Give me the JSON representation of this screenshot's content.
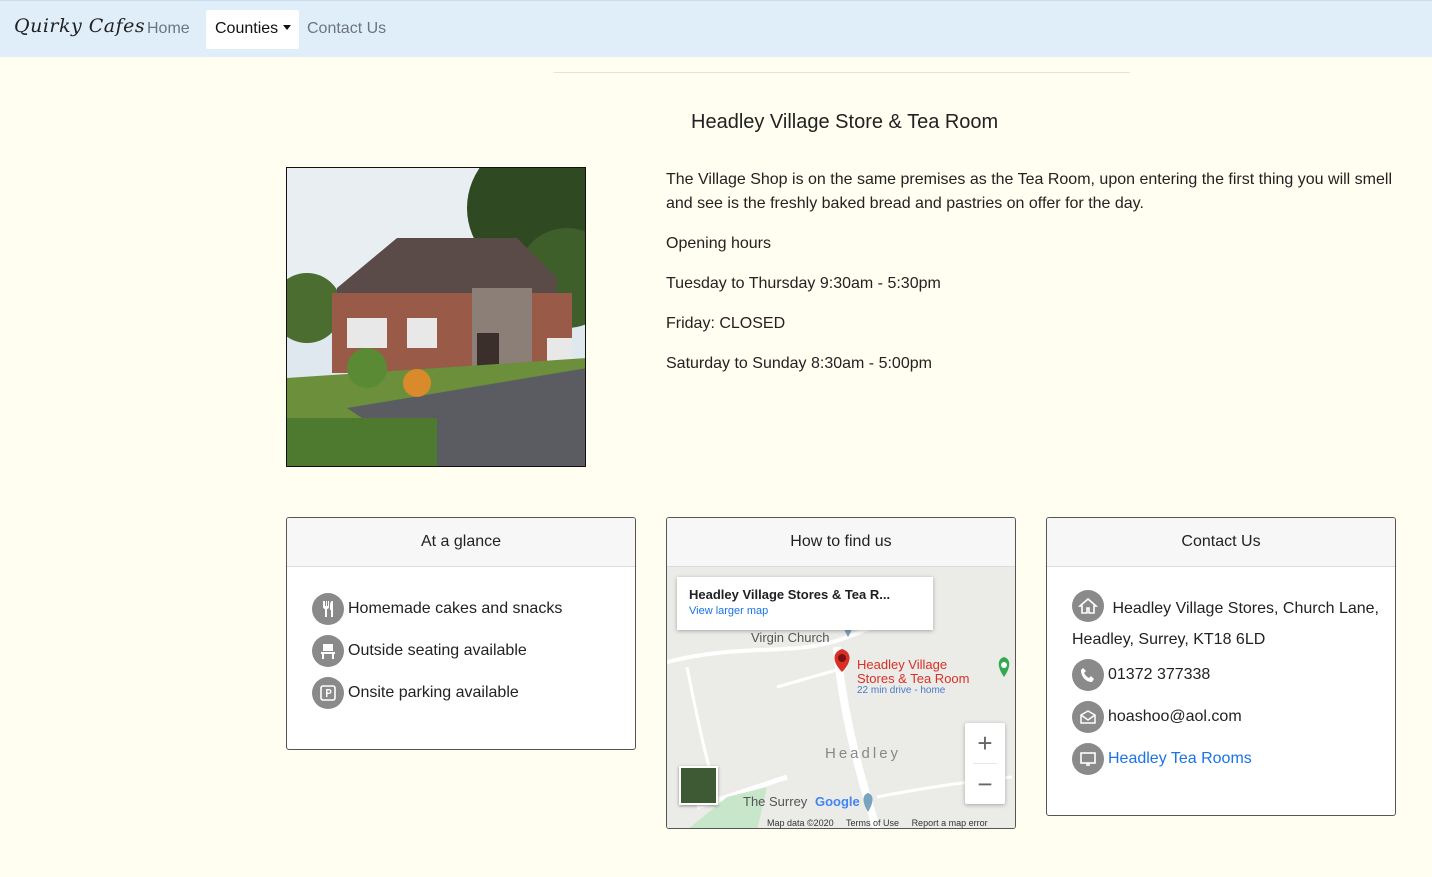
{
  "nav": {
    "brand": "Quirky Cafes",
    "home": "Home",
    "counties": "Counties",
    "contact": "Contact Us"
  },
  "page": {
    "title": "Headley Village Store & Tea Room"
  },
  "description": {
    "intro": "The Village Shop is on the same premises as the Tea Room, upon entering the first thing you will smell and see is the freshly baked bread and pastries on offer for the day.",
    "hours_heading": "Opening hours",
    "hours": [
      "Tuesday to Thursday 9:30am - 5:30pm",
      "Friday: CLOSED",
      "Saturday to Sunday 8:30am - 5:00pm"
    ]
  },
  "glance": {
    "heading": "At a glance",
    "items": [
      {
        "icon": "cutlery-icon",
        "text": "Homemade cakes and snacks"
      },
      {
        "icon": "bench-icon",
        "text": "Outside seating available"
      },
      {
        "icon": "parking-icon",
        "text": "Onsite parking available"
      }
    ]
  },
  "find": {
    "heading": "How to find us",
    "map_place": "Headley Village Stores & Tea R...",
    "map_link": "View larger map",
    "pin_label_1": "Headley Village",
    "pin_label_2": "Stores & Tea Room",
    "pin_sub": "22 min drive - home",
    "label_church": "Virgin Church",
    "label_town": "Headley",
    "label_surrey": "The Surrey",
    "google": "Google",
    "zoom_in": "+",
    "zoom_out": "−",
    "footer_data": "Map data ©2020",
    "footer_terms": "Terms of Use",
    "footer_report": "Report a map error"
  },
  "contact": {
    "heading": "Contact Us",
    "address_1": "Headley Village Stores, Church Lane,",
    "address_2": "Headley, Surrey, KT18 6LD",
    "phone": "01372 377338",
    "email": "hoashoo@aol.com",
    "website": "Headley Tea Rooms"
  },
  "colors": {
    "nav_bg": "#e0eefa",
    "page_bg": "#fffef0",
    "link": "#1a73e8",
    "icon_bg": "#8a8a8a"
  }
}
